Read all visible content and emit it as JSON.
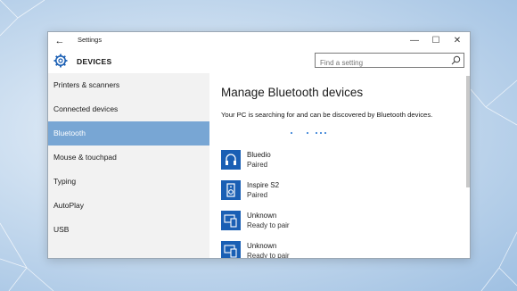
{
  "window": {
    "title": "Settings",
    "back_glyph": "←",
    "minimize_glyph": "—",
    "maximize_glyph": "☐",
    "close_glyph": "✕"
  },
  "header": {
    "title": "DEVICES",
    "icon": "gear-icon",
    "search_placeholder": "Find a setting"
  },
  "sidebar": {
    "items": [
      {
        "label": "Printers & scanners",
        "active": false
      },
      {
        "label": "Connected devices",
        "active": false
      },
      {
        "label": "Bluetooth",
        "active": true
      },
      {
        "label": "Mouse & touchpad",
        "active": false
      },
      {
        "label": "Typing",
        "active": false
      },
      {
        "label": "AutoPlay",
        "active": false
      },
      {
        "label": "USB",
        "active": false
      }
    ]
  },
  "main": {
    "title": "Manage Bluetooth devices",
    "description": "Your PC is searching for and can be discovered by Bluetooth devices.",
    "devices": [
      {
        "name": "Bluedio",
        "status": "Paired",
        "icon": "headphones-icon"
      },
      {
        "name": "Inspire S2",
        "status": "Paired",
        "icon": "speaker-icon"
      },
      {
        "name": "Unknown",
        "status": "Ready to pair",
        "icon": "device-icon"
      },
      {
        "name": "Unknown",
        "status": "Ready to pair",
        "icon": "device-icon"
      }
    ]
  },
  "colors": {
    "accent": "#78a6d4",
    "icon_tile": "#1a5fb4",
    "progress_dots": "#1b6fd1"
  }
}
